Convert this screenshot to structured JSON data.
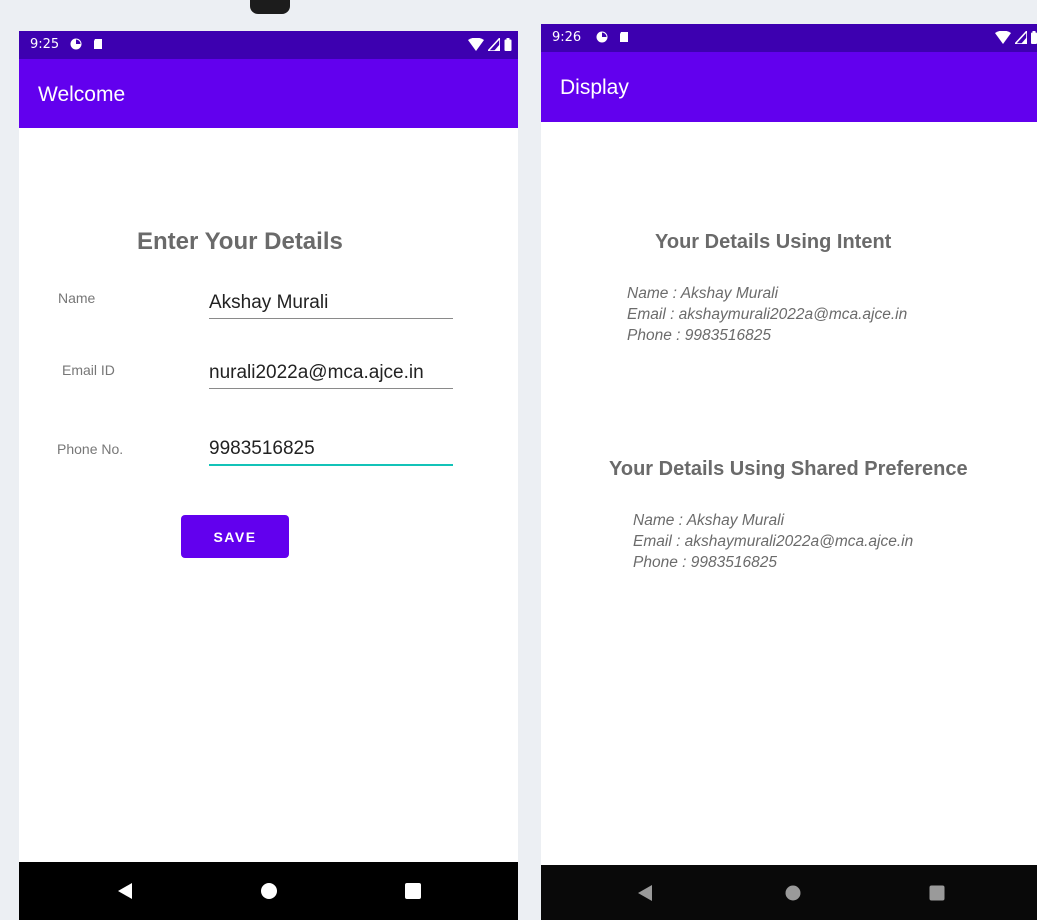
{
  "screens": [
    {
      "status_bar": {
        "time": "9:25"
      },
      "app_bar": {
        "title": "Welcome"
      },
      "form": {
        "heading": "Enter Your Details",
        "fields": [
          {
            "label": "Name",
            "value": "Akshay Murali"
          },
          {
            "label": "Email ID",
            "value": "nurali2022a@mca.ajce.in"
          },
          {
            "label": "Phone No.",
            "value": "9983516825"
          }
        ],
        "save_label": "SAVE"
      }
    },
    {
      "status_bar": {
        "time": "9:26"
      },
      "app_bar": {
        "title": "Display"
      },
      "sections": [
        {
          "heading": "Your Details Using Intent",
          "lines": [
            "Name : Akshay Murali",
            "Email : akshaymurali2022a@mca.ajce.in",
            "Phone : 9983516825"
          ]
        },
        {
          "heading": "Your Details Using Shared Preference",
          "lines": [
            "Name : Akshay Murali",
            "Email : akshaymurali2022a@mca.ajce.in",
            "Phone : 9983516825"
          ]
        }
      ]
    }
  ],
  "icons": {
    "status_left": [
      "pie-notification-icon",
      "sd-card-icon"
    ],
    "status_right": [
      "wifi-icon",
      "cell-signal-icon",
      "battery-icon"
    ],
    "nav": [
      "back-icon",
      "home-icon",
      "recents-icon"
    ]
  },
  "colors": {
    "status_bar": "#3d00b0",
    "app_bar": "#6200ee",
    "button": "#6200ee",
    "input_focus": "#13c3b8"
  }
}
